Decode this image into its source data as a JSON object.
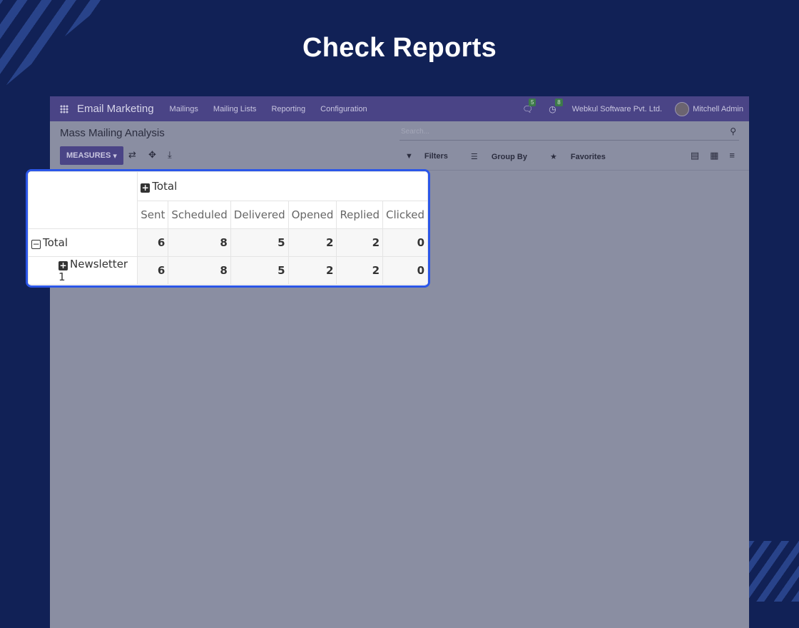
{
  "heading": "Check Reports",
  "navbar": {
    "brand": "Email Marketing",
    "menu": [
      "Mailings",
      "Mailing Lists",
      "Reporting",
      "Configuration"
    ],
    "chat_badge": "5",
    "activity_badge": "8",
    "company": "Webkul Software Pvt. Ltd.",
    "user": "Mitchell Admin"
  },
  "control_panel": {
    "breadcrumb": "Mass Mailing Analysis",
    "search_placeholder": "Search...",
    "measures_label": "MEASURES",
    "filters_label": "Filters",
    "group_by_label": "Group By",
    "favorites_label": "Favorites"
  },
  "pivot": {
    "column_group": "Total",
    "columns": [
      "Sent",
      "Scheduled",
      "Delivered",
      "Opened",
      "Replied",
      "Clicked"
    ],
    "rows": [
      {
        "label": "Total",
        "values": [
          "6",
          "8",
          "5",
          "2",
          "2",
          "0"
        ]
      },
      {
        "label": "Newsletter 1",
        "values": [
          "6",
          "8",
          "5",
          "2",
          "2",
          "0"
        ]
      }
    ]
  },
  "colors": {
    "background": "#112156",
    "navbar": "#4a4486",
    "highlight_border": "#2b56e8"
  }
}
